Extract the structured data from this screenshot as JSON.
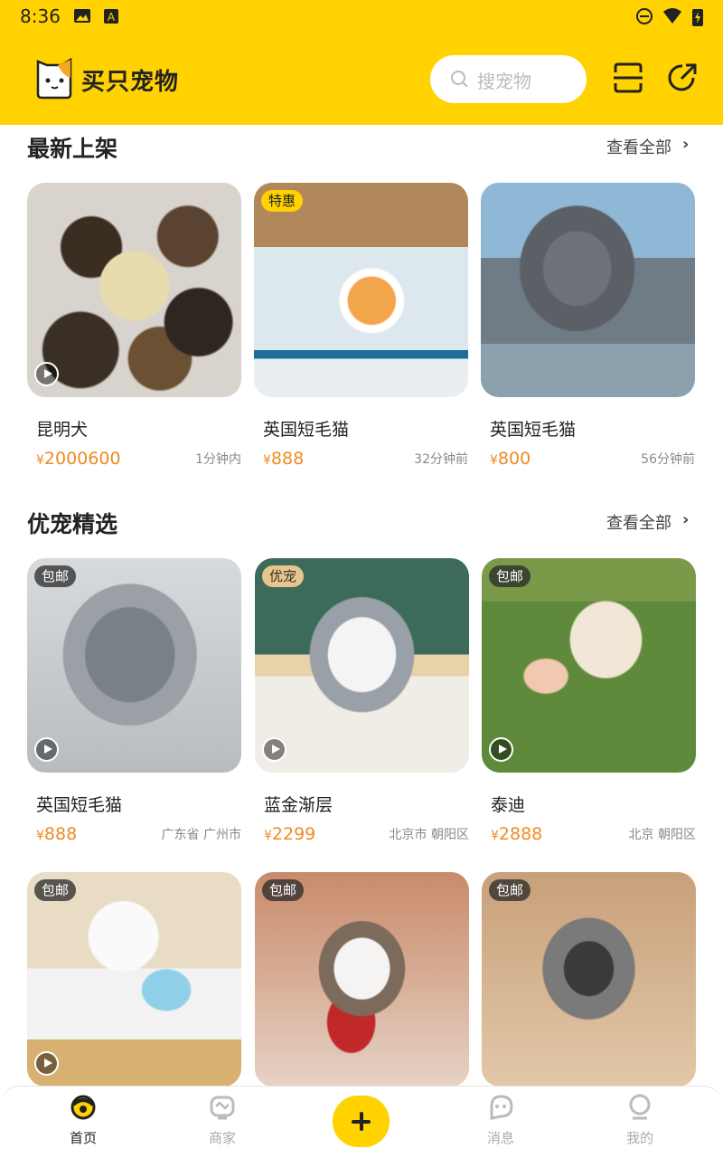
{
  "status_bar": {
    "time": "8:36"
  },
  "header": {
    "app_name": "买只宠物",
    "search_placeholder": "搜宠物"
  },
  "sections": {
    "latest": {
      "title": "最新上架",
      "see_all": "查看全部",
      "items": [
        {
          "name": "昆明犬",
          "currency": "¥",
          "price": "2000600",
          "meta": "1分钟内",
          "tag": "",
          "image": "puppies-eating"
        },
        {
          "name": "英国短毛猫",
          "currency": "¥",
          "price": "888",
          "meta": "32分钟前",
          "tag": "特惠",
          "image": "orange-kitten"
        },
        {
          "name": "英国短毛猫",
          "currency": "¥",
          "price": "800",
          "meta": "56分钟前",
          "tag": "",
          "image": "gray-kitten"
        }
      ]
    },
    "featured": {
      "title": "优宠精选",
      "see_all": "查看全部",
      "items": [
        {
          "name": "英国短毛猫",
          "currency": "¥",
          "price": "888",
          "meta": "广东省 广州市",
          "tag": "包邮",
          "image": "fluffy-gray-kitten"
        },
        {
          "name": "蓝金渐层",
          "currency": "¥",
          "price": "2299",
          "meta": "北京市 朝阳区",
          "tag": "优宠",
          "image": "white-gray-kitten"
        },
        {
          "name": "泰迪",
          "currency": "¥",
          "price": "2888",
          "meta": "北京 朝阳区",
          "tag": "包邮",
          "image": "teddy-puppy"
        },
        {
          "name": "",
          "currency": "",
          "price": "",
          "meta": "",
          "tag": "包邮",
          "image": "white-bichon"
        },
        {
          "name": "",
          "currency": "",
          "price": "",
          "meta": "",
          "tag": "包邮",
          "image": "ragdoll-kitten"
        },
        {
          "name": "",
          "currency": "",
          "price": "",
          "meta": "",
          "tag": "包邮",
          "image": "schnauzer-puppy"
        }
      ]
    }
  },
  "nav": {
    "items": [
      {
        "label": "首页",
        "icon": "home-icon",
        "active": true
      },
      {
        "label": "商家",
        "icon": "shop-icon"
      },
      {
        "label": "",
        "icon": "add-icon"
      },
      {
        "label": "消息",
        "icon": "message-icon"
      },
      {
        "label": "我的",
        "icon": "profile-icon"
      }
    ]
  },
  "colors": {
    "brand": "#FFD200",
    "price": "#F08A24"
  }
}
